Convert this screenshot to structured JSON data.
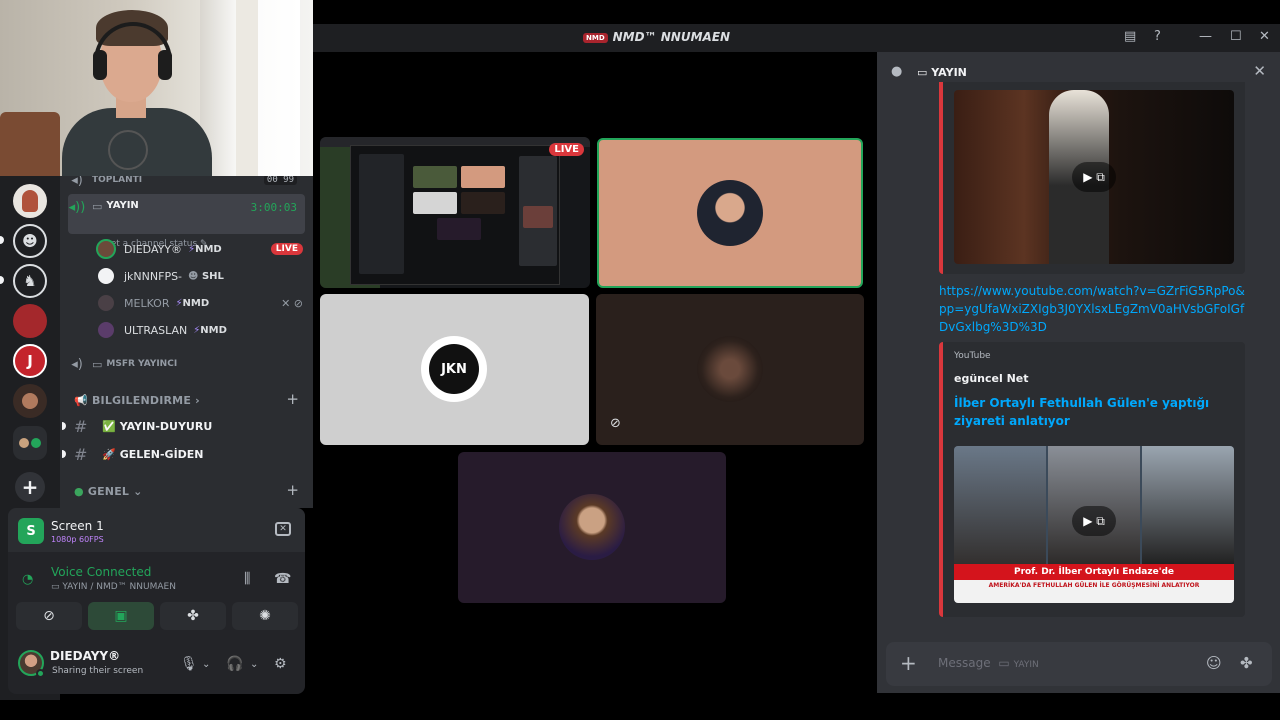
{
  "window": {
    "title": "NMD™ NNUMAEN",
    "logo_text": "NMD",
    "controls": [
      "inbox-icon",
      "help-icon",
      "minimize-icon",
      "maximize-icon",
      "close-icon"
    ]
  },
  "colors": {
    "accent_green": "#23a55a",
    "live_red": "#da373c",
    "link_blue": "#00a8fc",
    "speaking_tile": "#d39a7f"
  },
  "channels": {
    "top_channel": "TOPLANTI",
    "top_channel_counts": "00 99",
    "active_voice": {
      "name": "YAYIN",
      "timer": "3:00:03",
      "status_hint": "Set a channel status"
    },
    "members": [
      {
        "name": "DIEDAYY®",
        "tag": "NMD",
        "live": "LIVE"
      },
      {
        "name": "jkNNNFPS-",
        "tag": "SHL"
      },
      {
        "name": "MELKOR",
        "tag": "NMD",
        "muted": "✕ ⊘"
      },
      {
        "name": "ULTRASLAN",
        "tag": "NMD"
      }
    ],
    "second_voice": "MSFR YAYINCI",
    "categories": [
      {
        "name": "BILGILENDIRME",
        "chevron": "›"
      },
      {
        "name": "GENEL",
        "chevron": "⌄"
      }
    ],
    "text_channels": [
      {
        "name": "YAYIN-DUYURU",
        "emoji": "✅"
      },
      {
        "name": "GELEN-GİDEN",
        "emoji": "🚀"
      }
    ]
  },
  "stream_panel": {
    "screen_title": "Screen 1",
    "screen_quality": "1080p 60FPS",
    "voice_status": "Voice Connected",
    "voice_location": "YAYIN / NMD™ NNUMAEN",
    "actions": [
      "camera-off-icon",
      "screen-share-icon",
      "activities-icon",
      "soundboard-icon"
    ]
  },
  "user": {
    "name": "DIEDAYY®",
    "status": "Sharing their screen"
  },
  "stage": {
    "live_label": "LIVE",
    "logo_tile_text": "JKN"
  },
  "chat": {
    "channel_name": "YAYIN",
    "link": "https://www.youtube.com/watch?v=GZrFiG5RpPo&pp=ygUfaWxiZXIgb3J0YXlsxLEgZmV0aHVsbGFoIGfDvGxlbg%3D%3D",
    "embed": {
      "provider": "YouTube",
      "author": "egüncel Net",
      "title": "İlber Ortaylı Fethullah Gülen'e yaptığı ziyareti anlatıyor",
      "banner": "Prof. Dr. İlber Ortaylı Endaze'de",
      "ticker": "AMERİKA'DA FETHULLAH GÜLEN İLE GÖRÜŞMESİNİ ANLATIYOR"
    },
    "input_placeholder": "Message",
    "input_channel": "YAYIN"
  }
}
